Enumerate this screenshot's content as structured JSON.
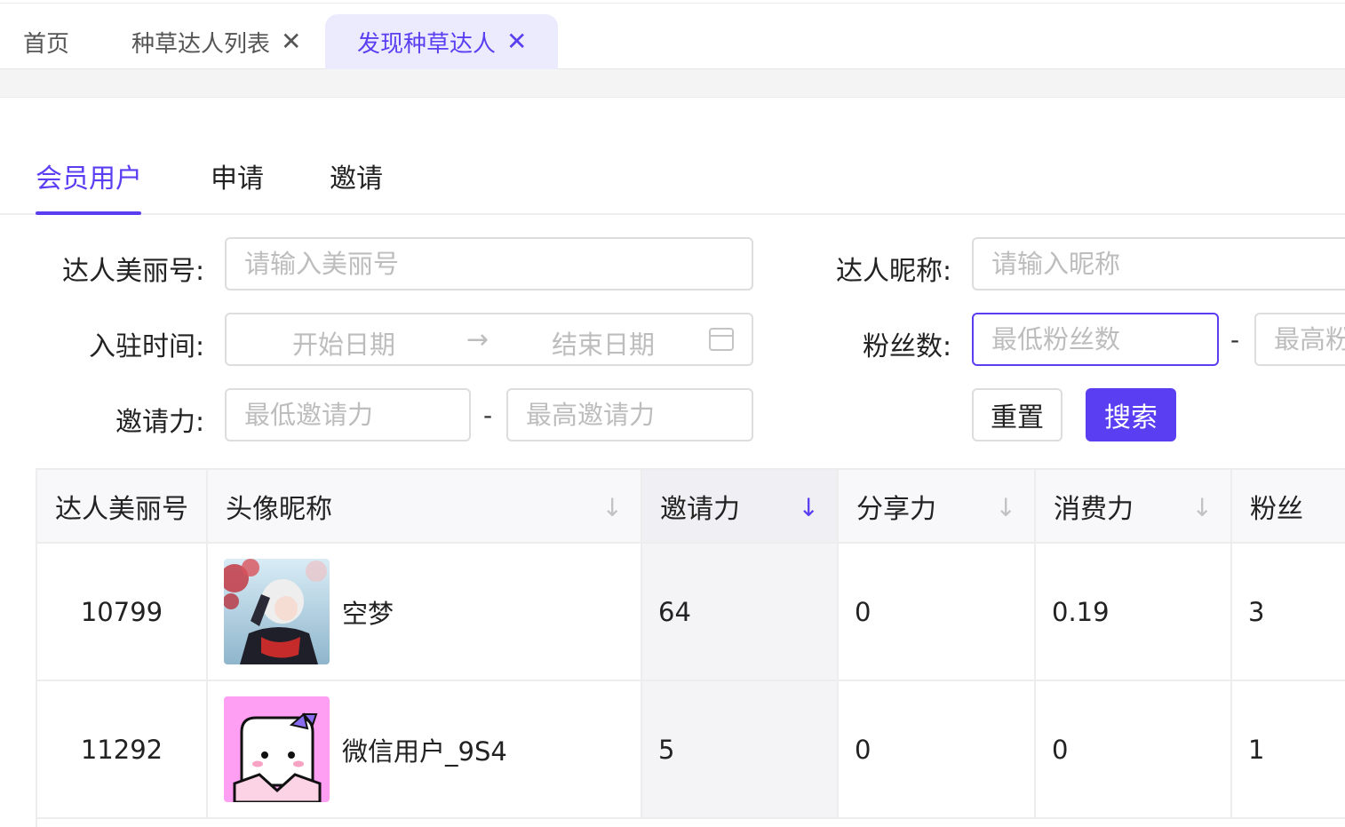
{
  "page_tabs": [
    {
      "label": "首页",
      "closable": false
    },
    {
      "label": "种草达人列表",
      "closable": true
    },
    {
      "label": "发现种草达人",
      "closable": true,
      "active": true
    }
  ],
  "close_glyph": "✕",
  "sub_tabs": [
    {
      "label": "会员用户",
      "active": true
    },
    {
      "label": "申请"
    },
    {
      "label": "邀请"
    }
  ],
  "filters": {
    "beauty_id": {
      "label": "达人美丽号:",
      "placeholder": "请输入美丽号"
    },
    "nickname": {
      "label": "达人昵称:",
      "placeholder": "请输入昵称"
    },
    "join_time": {
      "label": "入驻时间:",
      "start_placeholder": "开始日期",
      "end_placeholder": "结束日期",
      "separator": "→"
    },
    "fans": {
      "label": "粉丝数:",
      "min_placeholder": "最低粉丝数",
      "max_placeholder": "最高粉丝数",
      "dash": "-"
    },
    "invite_power": {
      "label": "邀请力:",
      "min_placeholder": "最低邀请力",
      "max_placeholder": "最高邀请力",
      "dash": "-"
    },
    "reset_label": "重置",
    "search_label": "搜索"
  },
  "table": {
    "sort_glyph": "↓",
    "columns": [
      "达人美丽号",
      "头像昵称",
      "邀请力",
      "分享力",
      "消费力",
      "粉丝"
    ],
    "rows": [
      {
        "beauty_id": "10799",
        "nickname": "空梦",
        "invite_power": "64",
        "share_power": "0",
        "consume_power": "0.19",
        "fans": "3"
      },
      {
        "beauty_id": "11292",
        "nickname": "微信用户_9S4",
        "invite_power": "5",
        "share_power": "0",
        "consume_power": "0",
        "fans": "1"
      }
    ]
  },
  "colors": {
    "accent": "#5a3ff2",
    "accent_light": "#ecebfd",
    "border": "#dddddd",
    "placeholder": "#bdbdbd",
    "avatar2_bg": "#ff9ff3"
  }
}
